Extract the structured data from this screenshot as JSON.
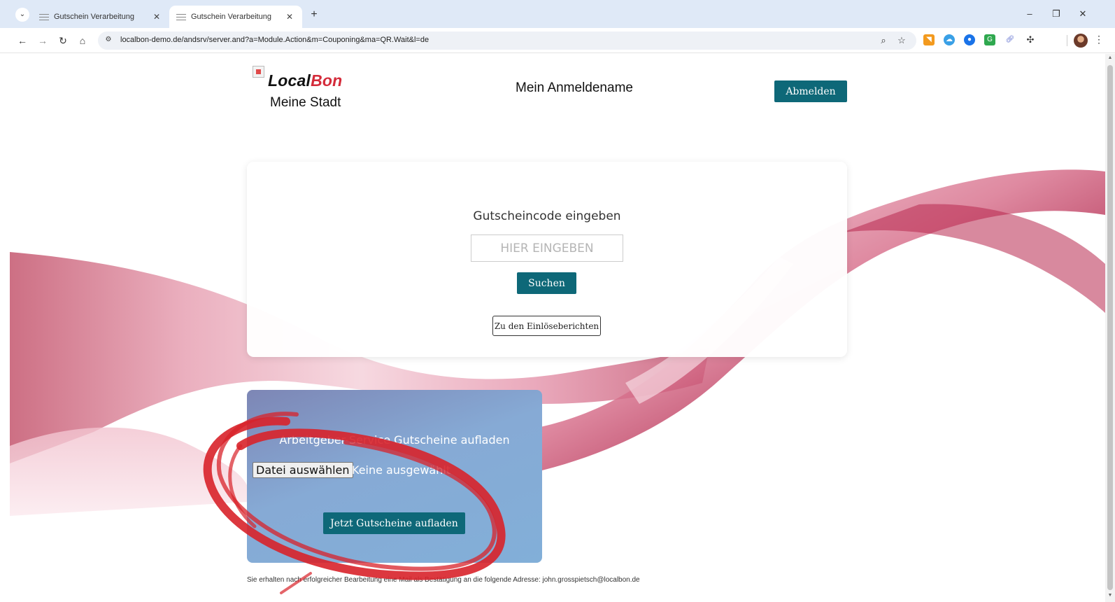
{
  "browser": {
    "tabs": [
      {
        "title": "Gutschein Verarbeitung",
        "active": false
      },
      {
        "title": "Gutschein Verarbeitung",
        "active": true
      }
    ],
    "new_tab_glyph": "+",
    "close_glyph": "✕",
    "url": "localbon-demo.de/andsrv/server.and?a=Module.Action&m=Couponing&ma=QR.Wait&l=de"
  },
  "header": {
    "brand_part1": "Local",
    "brand_part2": "Bon",
    "city": "Meine Stadt",
    "user_name": "Mein Anmeldename",
    "logout_label": "Abmelden"
  },
  "code_card": {
    "title": "Gutscheincode eingeben",
    "input_value": "",
    "input_placeholder": "HIER EINGEBEN",
    "search_label": "Suchen",
    "reports_label": "Zu den Einlöseberichten"
  },
  "upload_card": {
    "title": "Arbeitgeber-Service Gutscheine aufladen",
    "file_button_label": "Datei auswählen",
    "file_status": "Keine ausgewählt",
    "upload_label": "Jetzt Gutscheine aufladen"
  },
  "footer": {
    "note": "Sie erhalten nach erfolgreicher Bearbeitung eine Mail als Bestätigung an die folgende Adresse: john.grosspietsch@localbon.de"
  },
  "colors": {
    "brand_red": "#d42b3a",
    "button_teal": "#0e6878",
    "annotation_red": "#d8222a",
    "ribbon_pink": "#c9506a"
  },
  "icons": [
    "tab-search-icon",
    "tab-favicon-icon",
    "close-icon",
    "plus-icon",
    "minimize-icon",
    "restore-icon",
    "back-icon",
    "forward-icon",
    "reload-icon",
    "home-icon",
    "site-info-icon",
    "zoom-icon",
    "bookmark-star-icon",
    "rss-icon",
    "cloud-icon",
    "extension-icon",
    "link-icon",
    "puzzle-icon",
    "kebab-menu-icon"
  ]
}
